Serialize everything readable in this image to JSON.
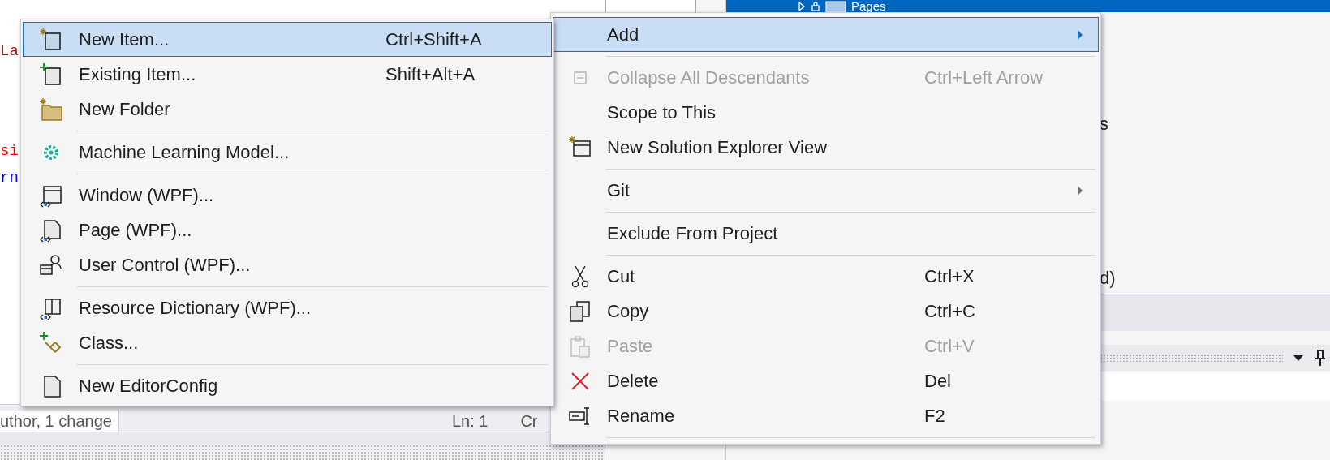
{
  "editor": {
    "code_fragments": [
      {
        "text": "La",
        "color": "#a31515"
      },
      {
        "text": "si",
        "color": "#ff0000"
      },
      {
        "text": "rn",
        "color": "#0000ff"
      }
    ],
    "status_bar": {
      "author": "uthor, 1 change",
      "line": "Ln: 1",
      "column": "Cr"
    }
  },
  "solution_explorer": {
    "selected_node": {
      "label": "Pages",
      "selected": true
    },
    "fragments": [
      "s",
      "d)"
    ]
  },
  "context_menu": {
    "items": [
      {
        "kind": "item",
        "label": "Add",
        "selected": true,
        "disabled": false,
        "submenu": true
      },
      {
        "kind": "separator"
      },
      {
        "kind": "item",
        "label": "Collapse All Descendants",
        "shortcut": "Ctrl+Left Arrow",
        "selected": false,
        "disabled": true,
        "submenu": false
      },
      {
        "kind": "item",
        "label": "Scope to This",
        "selected": false,
        "disabled": false,
        "submenu": false
      },
      {
        "kind": "item",
        "label": "New Solution Explorer View",
        "selected": false,
        "disabled": false,
        "submenu": false
      },
      {
        "kind": "separator"
      },
      {
        "kind": "item",
        "label": "Git",
        "selected": false,
        "disabled": false,
        "submenu": true
      },
      {
        "kind": "separator"
      },
      {
        "kind": "item",
        "label": "Exclude From Project",
        "selected": false,
        "disabled": false,
        "submenu": false
      },
      {
        "kind": "separator"
      },
      {
        "kind": "item",
        "label": "Cut",
        "shortcut": "Ctrl+X",
        "selected": false,
        "disabled": false,
        "submenu": false
      },
      {
        "kind": "item",
        "label": "Copy",
        "shortcut": "Ctrl+C",
        "selected": false,
        "disabled": false,
        "submenu": false
      },
      {
        "kind": "item",
        "label": "Paste",
        "shortcut": "Ctrl+V",
        "selected": false,
        "disabled": true,
        "submenu": false
      },
      {
        "kind": "item",
        "label": "Delete",
        "shortcut": "Del",
        "selected": false,
        "disabled": false,
        "submenu": false
      },
      {
        "kind": "item",
        "label": "Rename",
        "shortcut": "F2",
        "selected": false,
        "disabled": false,
        "submenu": false
      },
      {
        "kind": "separator"
      }
    ]
  },
  "add_submenu": {
    "items": [
      {
        "kind": "item",
        "label": "New Item...",
        "shortcut": "Ctrl+Shift+A",
        "selected": true,
        "disabled": false
      },
      {
        "kind": "item",
        "label": "Existing Item...",
        "shortcut": "Shift+Alt+A",
        "selected": false,
        "disabled": false
      },
      {
        "kind": "item",
        "label": "New Folder",
        "selected": false,
        "disabled": false
      },
      {
        "kind": "separator"
      },
      {
        "kind": "item",
        "label": "Machine Learning Model...",
        "selected": false,
        "disabled": false
      },
      {
        "kind": "separator"
      },
      {
        "kind": "item",
        "label": "Window (WPF)...",
        "selected": false,
        "disabled": false
      },
      {
        "kind": "item",
        "label": "Page (WPF)...",
        "selected": false,
        "disabled": false
      },
      {
        "kind": "item",
        "label": "User Control (WPF)...",
        "selected": false,
        "disabled": false
      },
      {
        "kind": "separator"
      },
      {
        "kind": "item",
        "label": "Resource Dictionary (WPF)...",
        "selected": false,
        "disabled": false
      },
      {
        "kind": "item",
        "label": "Class...",
        "selected": false,
        "disabled": false
      },
      {
        "kind": "separator"
      },
      {
        "kind": "item",
        "label": "New EditorConfig",
        "selected": false,
        "disabled": false
      }
    ]
  }
}
